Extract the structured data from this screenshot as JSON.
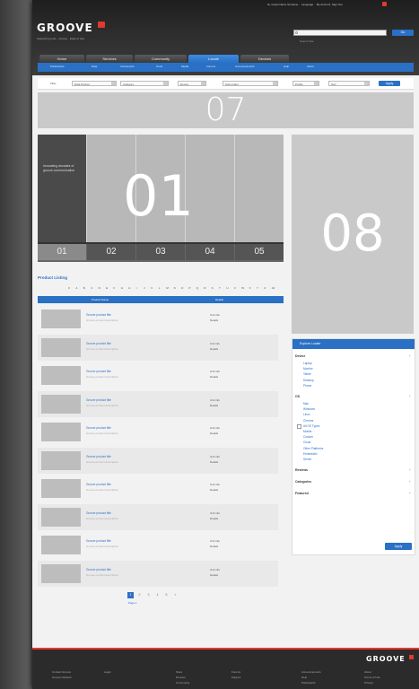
{
  "header": {
    "logo_text": "GROOVE",
    "tagline": "Supporting tools · Groove · Ease of Use",
    "top_links": [
      "Hi, Guest Name Surname",
      "Language",
      "My Account",
      "Sign Out"
    ],
    "search_placeholder": "Search Site",
    "search_button": "Go"
  },
  "nav": {
    "tabs": [
      "Home",
      "Services",
      "Community",
      "Locate",
      "Devices"
    ],
    "active_index": 3,
    "subnav": [
      "Participants",
      "Data",
      "Instruments",
      "Tools",
      "Media",
      "Forums",
      "Announcements",
      "Help",
      "About"
    ]
  },
  "filter_bar": {
    "label": "Filter",
    "selects": [
      "Data Partner",
      "Category",
      "Device",
      "Sub-model",
      "Profile",
      "Sort"
    ],
    "button": "Apply"
  },
  "banner": {
    "label": "07"
  },
  "carousel": {
    "caption": "Innovating decades of groove communication",
    "big_label": "01",
    "tabs": [
      "01",
      "02",
      "03",
      "04",
      "05"
    ],
    "active_tab": 0
  },
  "side_placeholder": {
    "label": "08"
  },
  "products": {
    "heading": "Product Listing",
    "alphabet": [
      "#",
      "A",
      "B",
      "C",
      "D",
      "E",
      "F",
      "G",
      "H",
      "I",
      "J",
      "K",
      "L",
      "M",
      "N",
      "O",
      "P",
      "Q",
      "R",
      "S",
      "T",
      "U",
      "V",
      "W",
      "X",
      "Y",
      "Z",
      "All"
    ],
    "columns": [
      "Product Name",
      "Details"
    ],
    "rows": [
      {
        "name": "Groove product title",
        "desc": "Groove product description",
        "d1": "Unit info",
        "d2": "Details"
      },
      {
        "name": "Groove product title",
        "desc": "Groove product description",
        "d1": "Unit info",
        "d2": "Details"
      },
      {
        "name": "Groove product title",
        "desc": "Groove product description",
        "d1": "Unit info",
        "d2": "Details"
      },
      {
        "name": "Groove product title",
        "desc": "Groove product description",
        "d1": "Unit info",
        "d2": "Details"
      },
      {
        "name": "Groove product title",
        "desc": "Groove product description",
        "d1": "Unit info",
        "d2": "Details"
      },
      {
        "name": "Groove product title",
        "desc": "Groove product description",
        "d1": "Unit info",
        "d2": "Details"
      },
      {
        "name": "Groove product title",
        "desc": "Groove product description",
        "d1": "Unit info",
        "d2": "Details"
      },
      {
        "name": "Groove product title",
        "desc": "Groove product description",
        "d1": "Unit info",
        "d2": "Details"
      },
      {
        "name": "Groove product title",
        "desc": "Groove product description",
        "d1": "Unit info",
        "d2": "Details"
      },
      {
        "name": "Groove product title",
        "desc": "Groove product description",
        "d1": "Unit info",
        "d2": "Details"
      }
    ],
    "pagination": [
      "1",
      "2",
      "3",
      "4",
      "5",
      "»"
    ],
    "pagination_label": "Page 1"
  },
  "filter_panel": {
    "title": "Explore Locate",
    "sections": [
      {
        "name": "Device",
        "items": [
          "Laptop",
          "Monitor",
          "Tablet",
          "Desktop",
          "Phone"
        ]
      },
      {
        "name": "OS",
        "items": [
          "Mac",
          "Windows",
          "Linux",
          "Chrome",
          "All OS Types",
          "Mobile",
          "Custom",
          "Cloud",
          "Other Platforms",
          "Embedded",
          "Server"
        ]
      },
      {
        "name": "Reviews",
        "items": []
      },
      {
        "name": "Categories",
        "items": []
      },
      {
        "name": "Featured",
        "items": []
      }
    ],
    "apply_button": "Apply"
  },
  "footer": {
    "logo_text": "GROOVE",
    "columns": [
      [
        "Contact Groove",
        "Groove Network"
      ],
      [
        "Legal"
      ],
      [
        "Store",
        "Devices",
        "Community"
      ],
      [
        "Forums",
        "Support"
      ],
      [
        "Announcements",
        "Help",
        "Participants"
      ],
      [
        "About",
        "Terms of Use",
        "Privacy"
      ]
    ]
  }
}
